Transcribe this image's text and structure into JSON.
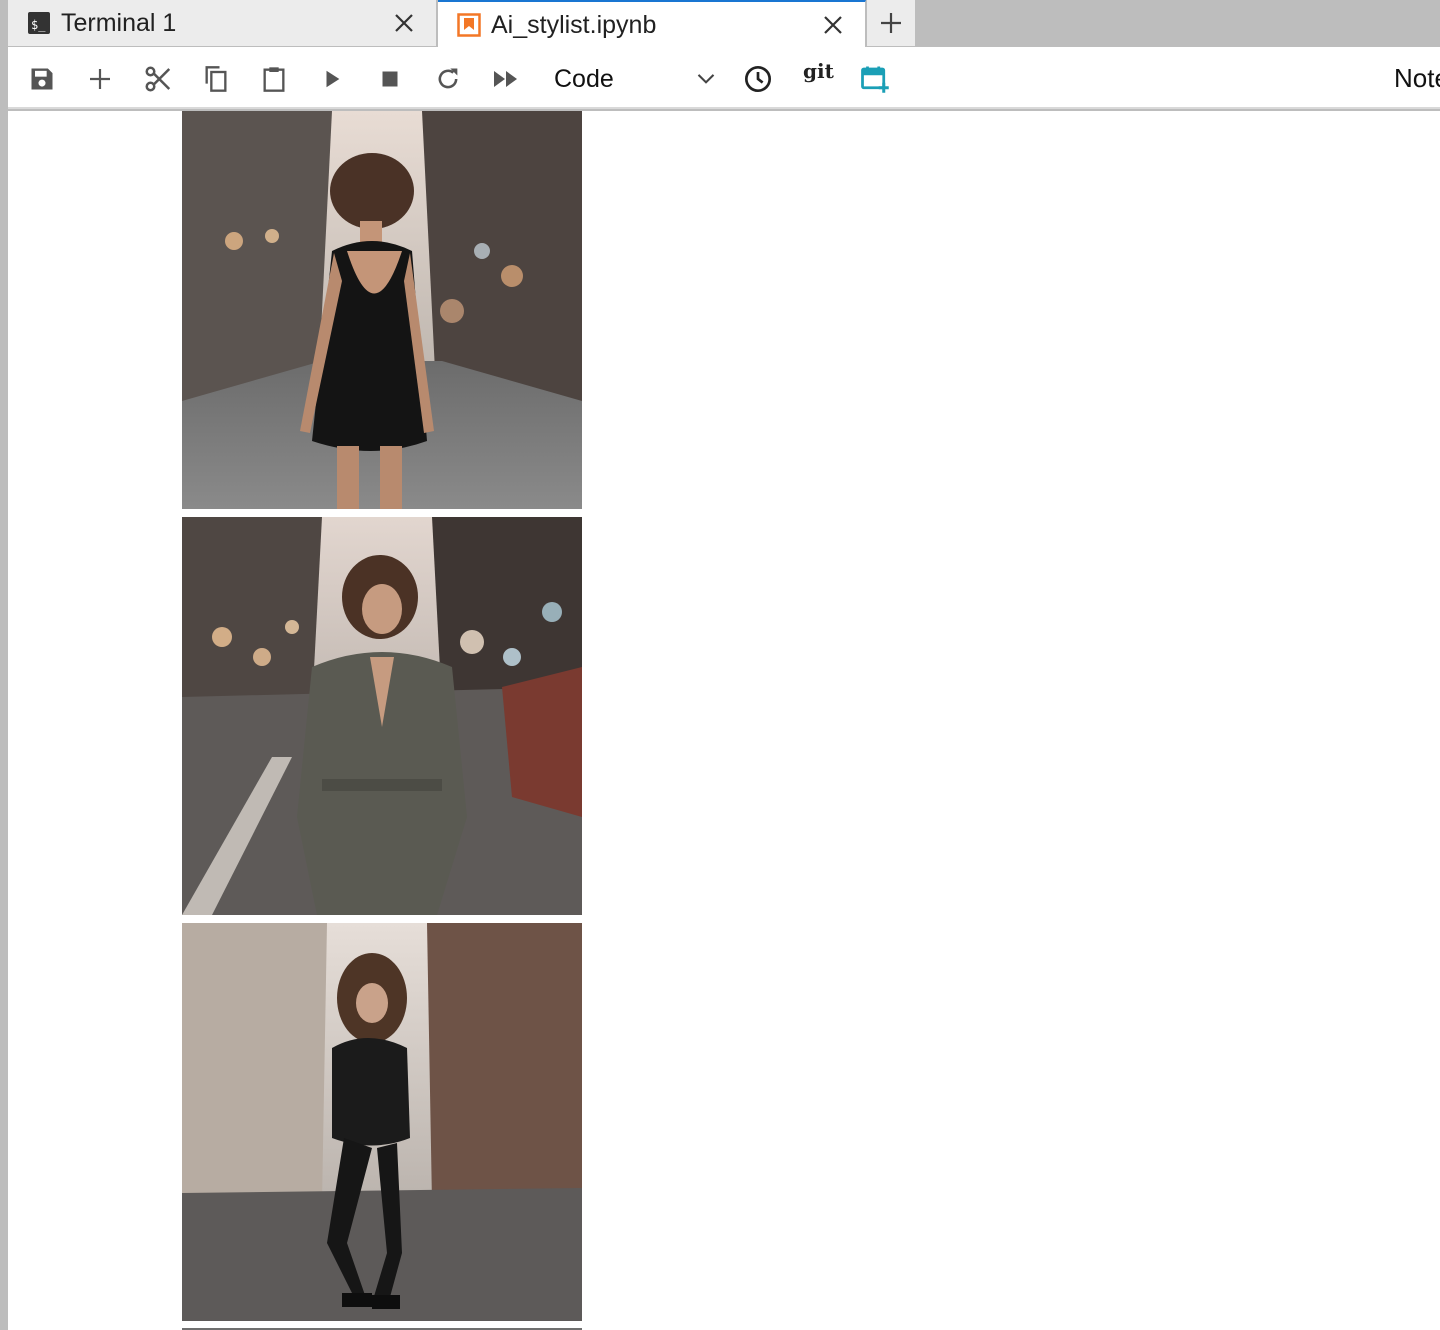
{
  "tabs": [
    {
      "label": "Terminal 1",
      "icon": "terminal-icon",
      "active": false
    },
    {
      "label": "Ai_stylist.ipynb",
      "icon": "notebook-icon",
      "active": true
    }
  ],
  "toolbar": {
    "cell_type": "Code",
    "git_label": "git",
    "kernel_label": "Note"
  },
  "outputs": [
    {
      "kind": "image",
      "subject": "woman-black-dress-back-view"
    },
    {
      "kind": "image",
      "subject": "woman-grey-jumpsuit"
    },
    {
      "kind": "image",
      "subject": "woman-black-leather-outfit"
    }
  ],
  "colors": {
    "accent": "#1976d2",
    "notebook_icon": "#f37726",
    "schedule_icon": "#1a9fb6",
    "chrome_grey": "#bdbdbd"
  }
}
